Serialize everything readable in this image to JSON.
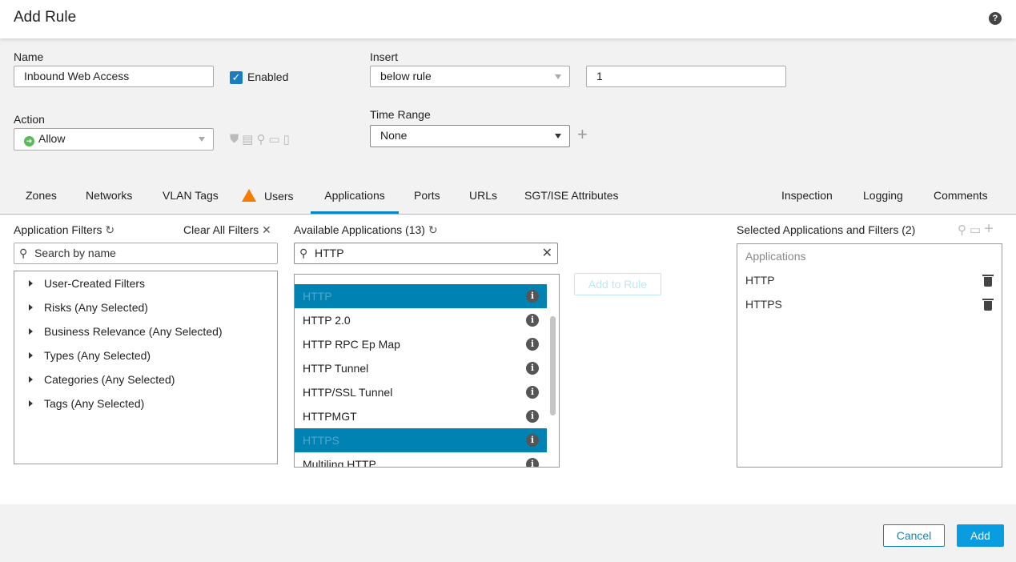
{
  "title": "Add Rule",
  "help_icon": "?",
  "form": {
    "name_label": "Name",
    "name_value": "Inbound Web Access",
    "enabled_label": "Enabled",
    "enabled": true,
    "insert_label": "Insert",
    "insert_value": "below rule",
    "insert_rule_value": "1",
    "action_label": "Action",
    "action_value": "Allow",
    "time_range_label": "Time Range",
    "time_range_value": "None"
  },
  "tabs": [
    {
      "label": "Zones"
    },
    {
      "label": "Networks"
    },
    {
      "label": "VLAN Tags"
    },
    {
      "label": "Users",
      "warning": true
    },
    {
      "label": "Applications",
      "active": true
    },
    {
      "label": "Ports"
    },
    {
      "label": "URLs"
    },
    {
      "label": "SGT/ISE Attributes"
    },
    {
      "label": "Inspection"
    },
    {
      "label": "Logging"
    },
    {
      "label": "Comments"
    }
  ],
  "filters": {
    "title": "Application Filters",
    "clear_label": "Clear All Filters",
    "search_placeholder": "Search by name",
    "items": [
      "User-Created Filters",
      "Risks (Any Selected)",
      "Business Relevance (Any Selected)",
      "Types (Any Selected)",
      "Categories (Any Selected)",
      "Tags (Any Selected)"
    ]
  },
  "available": {
    "title": "Available Applications (13)",
    "search_value": "HTTP",
    "items": [
      {
        "label": "HTTP",
        "selected": true
      },
      {
        "label": "HTTP 2.0"
      },
      {
        "label": "HTTP RPC Ep Map"
      },
      {
        "label": "HTTP Tunnel"
      },
      {
        "label": "HTTP/SSL Tunnel"
      },
      {
        "label": "HTTPMGT"
      },
      {
        "label": "HTTPS",
        "selected": true
      },
      {
        "label": "Multiling HTTP"
      }
    ]
  },
  "add_to_rule_label": "Add to Rule",
  "selected": {
    "title": "Selected Applications and Filters (2)",
    "group_label": "Applications",
    "items": [
      "HTTP",
      "HTTPS"
    ]
  },
  "footer": {
    "cancel_label": "Cancel",
    "add_label": "Add"
  },
  "colors": {
    "accent": "#0083b3",
    "primary_button": "#0a9ce0",
    "allow_green": "#5cb85c",
    "warning": "#f57c00"
  }
}
